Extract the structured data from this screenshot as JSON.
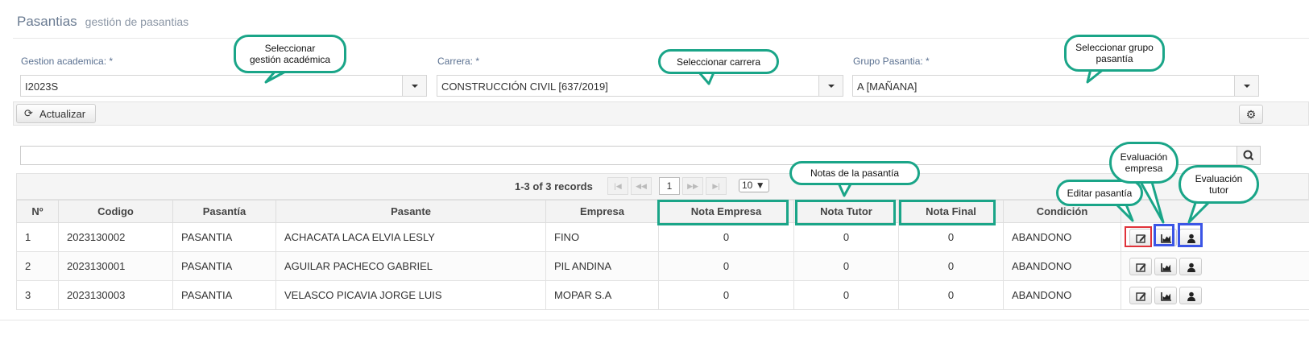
{
  "header": {
    "title": "Pasantias",
    "subtitle": "gestión de pasantias"
  },
  "filters": {
    "gestion": {
      "label": "Gestion academica: *",
      "value": "I2023S"
    },
    "carrera": {
      "label": "Carrera: *",
      "value": "CONSTRUCCIÓN CIVIL [637/2019]"
    },
    "grupo": {
      "label": "Grupo Pasantia: *",
      "value": "A [MAÑANA]"
    }
  },
  "toolbar": {
    "refresh_label": "Actualizar"
  },
  "pager": {
    "records": "1-3 of 3 records",
    "current_page": "1",
    "rows_per_page": "10"
  },
  "table": {
    "headers": [
      "Nº",
      "Codigo",
      "Pasantía",
      "Pasante",
      "Empresa",
      "Nota Empresa",
      "Nota Tutor",
      "Nota Final",
      "Condición",
      ""
    ],
    "rows": [
      [
        "1",
        "2023130002",
        "PASANTIA",
        "ACHACATA LACA ELVIA LESLY",
        "FINO",
        "0",
        "0",
        "0",
        "ABANDONO"
      ],
      [
        "2",
        "2023130001",
        "PASANTIA",
        "AGUILAR PACHECO GABRIEL",
        "PIL ANDINA",
        "0",
        "0",
        "0",
        "ABANDONO"
      ],
      [
        "3",
        "2023130003",
        "PASANTIA",
        "VELASCO PICAVIA JORGE LUIS",
        "MOPAR S.A",
        "0",
        "0",
        "0",
        "ABANDONO"
      ]
    ]
  },
  "annotations": {
    "gestion": "Seleccionar\ngestión académica",
    "carrera": "Seleccionar carrera",
    "grupo": "Seleccionar grupo\npasantía",
    "notas": "Notas de la pasantía",
    "editar": "Editar pasantía",
    "eval_empresa": "Evaluación\nempresa",
    "eval_tutor": "Evaluación\ntutor"
  },
  "colors": {
    "annotation_green": "#1aa588",
    "highlight_red": "#e0323a",
    "highlight_blue": "#3b55e6"
  },
  "icons": [
    "refresh-icon",
    "gear-icon",
    "search-icon",
    "edit-icon",
    "chart-icon",
    "user-icon"
  ]
}
